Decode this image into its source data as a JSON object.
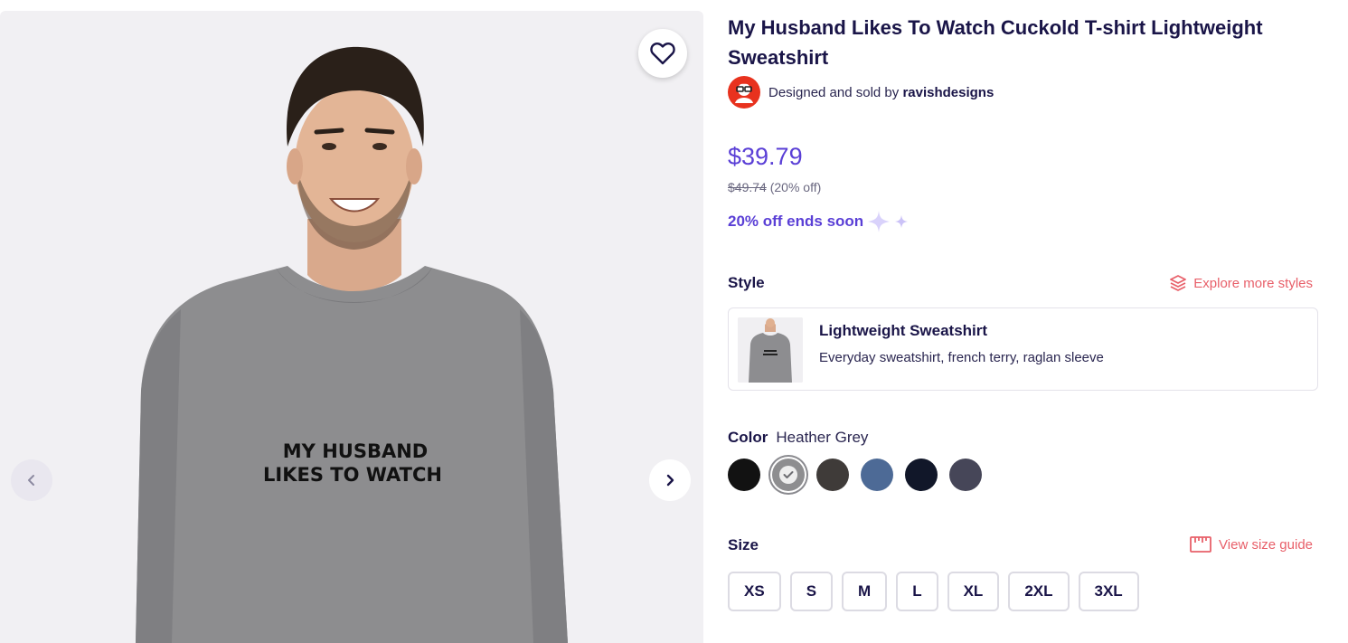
{
  "product": {
    "title": "My Husband Likes To Watch Cuckold T-shirt Lightweight Sweatshirt",
    "seller_prefix": "Designed and sold by",
    "seller_name": "ravishdesigns",
    "price": "$39.79",
    "original_price": "$49.74",
    "discount_text": "(20% off)",
    "sale_text": "20% off ends soon",
    "shirt_print_line1": "MY HUSBAND",
    "shirt_print_line2": "LIKES TO WATCH"
  },
  "style": {
    "label": "Style",
    "explore_link": "Explore more styles",
    "selected_name": "Lightweight Sweatshirt",
    "selected_desc": "Everyday sweatshirt, french terry, raglan sleeve"
  },
  "color": {
    "label": "Color",
    "selected": "Heather Grey",
    "swatches": [
      {
        "hex": "#121212",
        "selected": false
      },
      {
        "hex": "#8e8e90",
        "selected": true
      },
      {
        "hex": "#3f3b39",
        "selected": false
      },
      {
        "hex": "#4d6a96",
        "selected": false
      },
      {
        "hex": "#111729",
        "selected": false
      },
      {
        "hex": "#464658",
        "selected": false
      }
    ]
  },
  "size": {
    "label": "Size",
    "guide_link": "View size guide",
    "options": [
      "XS",
      "S",
      "M",
      "L",
      "XL",
      "2XL",
      "3XL"
    ]
  },
  "icons": {
    "favorite": "heart-icon",
    "prev": "chevron-left-icon",
    "next": "chevron-right-icon",
    "styles": "layers-icon",
    "size_guide": "ruler-icon"
  },
  "colors": {
    "brand_purple": "#5a3fd6",
    "link_coral": "#e8606a",
    "heading": "#1a1548",
    "gallery_bg": "#f1f0f3"
  }
}
